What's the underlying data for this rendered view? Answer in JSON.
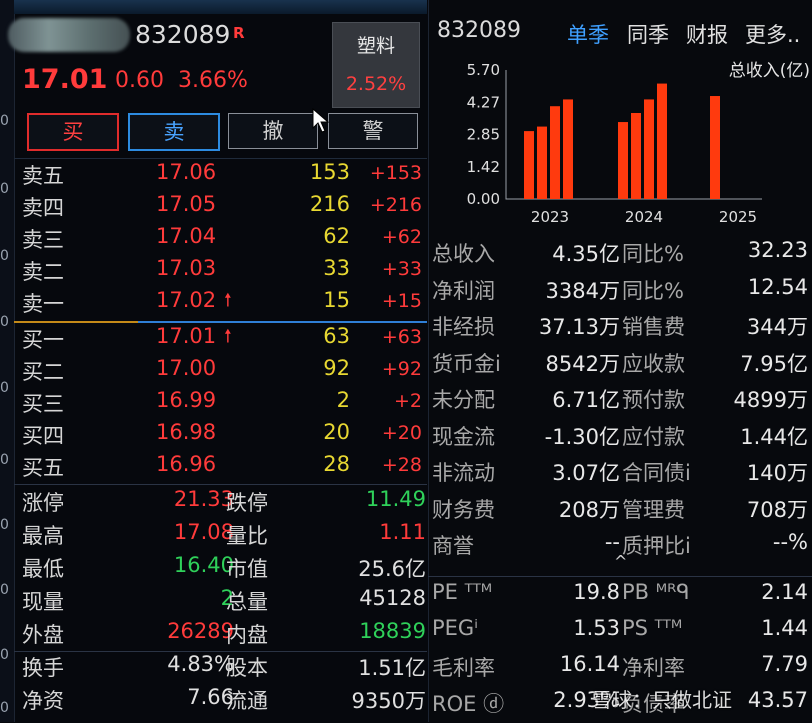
{
  "left_edge_glyphs": [
    "0",
    "0",
    "0",
    "0",
    "0",
    "0",
    "0",
    "0",
    "0",
    "0"
  ],
  "header": {
    "code": "832089",
    "flag": "R",
    "price": "17.01",
    "change": "0.60",
    "change_pct": "3.66%",
    "sector_name": "塑料",
    "sector_pct": "2.52%"
  },
  "buttons": {
    "buy": "买",
    "sell": "卖",
    "cancel": "撤",
    "alert": "警"
  },
  "asks": [
    {
      "label": "卖五",
      "price": "17.06",
      "vol": "153",
      "delta": "+153"
    },
    {
      "label": "卖四",
      "price": "17.05",
      "vol": "216",
      "delta": "+216"
    },
    {
      "label": "卖三",
      "price": "17.04",
      "vol": "62",
      "delta": "+62"
    },
    {
      "label": "卖二",
      "price": "17.03",
      "vol": "33",
      "delta": "+33"
    },
    {
      "label": "卖一",
      "price": "17.02",
      "vol": "15",
      "delta": "+15"
    }
  ],
  "bids": [
    {
      "label": "买一",
      "price": "17.01",
      "vol": "63",
      "delta": "+63"
    },
    {
      "label": "买二",
      "price": "17.00",
      "vol": "92",
      "delta": "+92"
    },
    {
      "label": "买三",
      "price": "16.99",
      "vol": "2",
      "delta": "+2"
    },
    {
      "label": "买四",
      "price": "16.98",
      "vol": "20",
      "delta": "+20"
    },
    {
      "label": "买五",
      "price": "16.96",
      "vol": "28",
      "delta": "+28"
    }
  ],
  "up_arrow": "🠕",
  "stats": [
    {
      "k1": "涨停",
      "v1": "21.33",
      "c1": "red",
      "k2": "跌停",
      "v2": "11.49",
      "c2": "green"
    },
    {
      "k1": "最高",
      "v1": "17.08",
      "c1": "red",
      "k2": "量比",
      "v2": "1.11",
      "c2": "red"
    },
    {
      "k1": "最低",
      "v1": "16.40",
      "c1": "green",
      "k2": "市值",
      "v2": "25.6亿",
      "c2": "white"
    },
    {
      "k1": "现量",
      "v1": "2",
      "c1": "green",
      "k2": "总量",
      "v2": "45128",
      "c2": "white"
    },
    {
      "k1": "外盘",
      "v1": "26289",
      "c1": "red",
      "k2": "内盘",
      "v2": "18839",
      "c2": "green"
    },
    {
      "k1": "换手",
      "v1": "4.83%",
      "c1": "white",
      "k2": "股本",
      "v2": "1.51亿",
      "c2": "white"
    },
    {
      "k1": "净资",
      "v1": "7.66",
      "c1": "white",
      "k2": "流通",
      "v2": "9350万",
      "c2": "white"
    }
  ],
  "right": {
    "code": "832089",
    "tabs": [
      "单季",
      "同季",
      "财报",
      "更多.."
    ],
    "fin": [
      {
        "k1": "总收入",
        "v1": "4.35亿",
        "k2": "同比%",
        "v2": "32.23"
      },
      {
        "k1": "净利润",
        "v1": "3384万",
        "k2": "同比%",
        "v2": "12.54"
      },
      {
        "k1": "非经损",
        "v1": "37.13万",
        "k2": "销售费",
        "v2": "344万"
      },
      {
        "k1": "货币金i",
        "v1": "8542万",
        "k2": "应收款",
        "v2": "7.95亿"
      },
      {
        "k1": "未分配",
        "v1": "6.71亿",
        "k2": "预付款",
        "v2": "4899万"
      },
      {
        "k1": "现金流",
        "v1": "-1.30亿",
        "k2": "应付款",
        "v2": "1.44亿"
      },
      {
        "k1": "非流动",
        "v1": "3.07亿",
        "k2": "合同债i",
        "v2": "140万"
      },
      {
        "k1": "财务费",
        "v1": "208万",
        "k2": "管理费",
        "v2": "708万"
      },
      {
        "k1": "商誉",
        "v1": "--",
        "k2": "质押比i",
        "v2": "--%"
      }
    ],
    "caret": "^",
    "valuation": [
      {
        "k1": "PE ᵀᵀᴹ",
        "v1": "19.8",
        "k2": "PB ᴹᴿᑫ",
        "v2": "2.14"
      },
      {
        "k1": "PEGⁱ",
        "v1": "1.53",
        "k2": "PS ᵀᵀᴹ",
        "v2": "1.44"
      },
      {
        "k1": "毛利率",
        "v1": "16.14",
        "k2": "净利率",
        "v2": "7.79"
      },
      {
        "k1": "ROE ⓓ",
        "v1": "2.93%",
        "k2": "负债率",
        "v2": "43.57"
      }
    ],
    "watermark": "雪球：只做北证"
  },
  "chart_data": {
    "type": "bar",
    "title": "总收入(亿)",
    "ylim": [
      0,
      5.7
    ],
    "yticks": [
      "5.70",
      "4.27",
      "2.85",
      "1.42",
      "0.00"
    ],
    "year_labels": [
      "2023",
      "2024",
      "2025"
    ],
    "groups": [
      {
        "year": "2023",
        "values": [
          3.0,
          3.2,
          4.1,
          4.4
        ]
      },
      {
        "year": "2024",
        "values": [
          3.4,
          3.8,
          4.4,
          5.1
        ]
      },
      {
        "year": "2025",
        "values": [
          4.55
        ]
      }
    ],
    "bar_color": "#ff3a0e",
    "grid": false
  }
}
